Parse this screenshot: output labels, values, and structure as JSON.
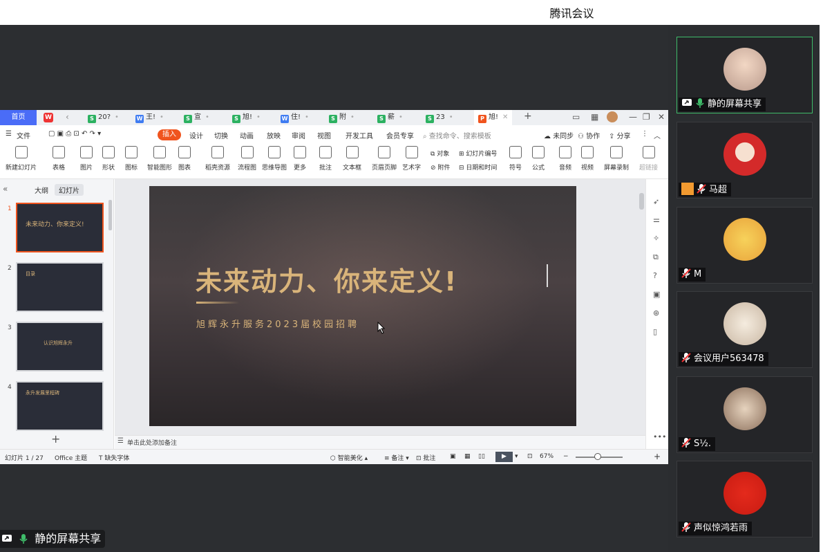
{
  "app": {
    "title": "腾讯会议"
  },
  "wps": {
    "home_tab": "首页",
    "doc_tabs": [
      {
        "icon": "S",
        "label": "20?",
        "color": "#2cb161"
      },
      {
        "icon": "W",
        "label": "王!",
        "color": "#3f7cf2"
      },
      {
        "icon": "S",
        "label": "宣",
        "color": "#2cb161"
      },
      {
        "icon": "S",
        "label": "旭!",
        "color": "#2cb161"
      },
      {
        "icon": "W",
        "label": "住!",
        "color": "#3f7cf2"
      },
      {
        "icon": "S",
        "label": "附",
        "color": "#2cb161"
      },
      {
        "icon": "S",
        "label": "薪",
        "color": "#2cb161"
      },
      {
        "icon": "S",
        "label": "23",
        "color": "#2cb161"
      },
      {
        "icon": "P",
        "label": "旭!",
        "color": "#f0541e"
      }
    ],
    "menu": {
      "file": "文件",
      "insert": "插入",
      "items": [
        "设计",
        "切换",
        "动画",
        "放映",
        "审阅",
        "视图",
        "开发工具",
        "会员专享"
      ],
      "search_placeholder": "查找命令、搜索模板",
      "unsynced": "未同步",
      "collab": "协作",
      "share": "分享"
    },
    "ribbon": [
      "新建幻灯片",
      "表格",
      "图片",
      "形状",
      "图标",
      "智能图形",
      "图表",
      "稻壳资源",
      "流程图",
      "思维导图",
      "更多",
      "批注",
      "文本框",
      "页眉页脚",
      "艺术字"
    ],
    "ribbon_small": {
      "object": "对象",
      "slide_number": "幻灯片编号",
      "attachment": "附件",
      "date_time": "日期和时间"
    },
    "ribbon_right": [
      "符号",
      "公式",
      "音频",
      "视频",
      "屏幕录制",
      "超链接"
    ],
    "left_panel": {
      "outline_tab": "大纲",
      "slides_tab": "幻灯片"
    },
    "thumbnails": [
      {
        "num": "1",
        "text": "未来动力、你来定义!"
      },
      {
        "num": "2",
        "text": "目录"
      },
      {
        "num": "3",
        "text": "认识旭辉永升"
      },
      {
        "num": "4",
        "text": "永升发展里程碑"
      }
    ],
    "slide": {
      "title": "未来动力、你来定义!",
      "subtitle": "旭辉永升服务2023届校园招聘"
    },
    "notes_placeholder": "单击此处添加备注",
    "status": {
      "slide_count": "幻灯片 1 / 27",
      "theme": "Office 主题",
      "missing_font": "缺失字体",
      "smart_beautify": "智能美化",
      "notes": "备注",
      "comments": "批注",
      "zoom": "67%"
    }
  },
  "participants": [
    {
      "name": "静的屏幕共享",
      "speaking": true,
      "mic": "on",
      "sharing": true
    },
    {
      "name": "马超",
      "speaking": false,
      "mic": "muted",
      "badge": "person-icon"
    },
    {
      "name": "M",
      "speaking": false,
      "mic": "muted"
    },
    {
      "name": "会议用户563478",
      "speaking": false,
      "mic": "muted"
    },
    {
      "name": "S½.",
      "speaking": false,
      "mic": "muted"
    },
    {
      "name": "声似惊鸿若雨",
      "speaking": false,
      "mic": "muted"
    }
  ],
  "bottom_share_label": "静的屏幕共享",
  "colors": {
    "accent": "#f0541e",
    "gold": "#d9b47a",
    "speaking": "#3fbd6a",
    "wps_blue": "#4a6cf7"
  }
}
